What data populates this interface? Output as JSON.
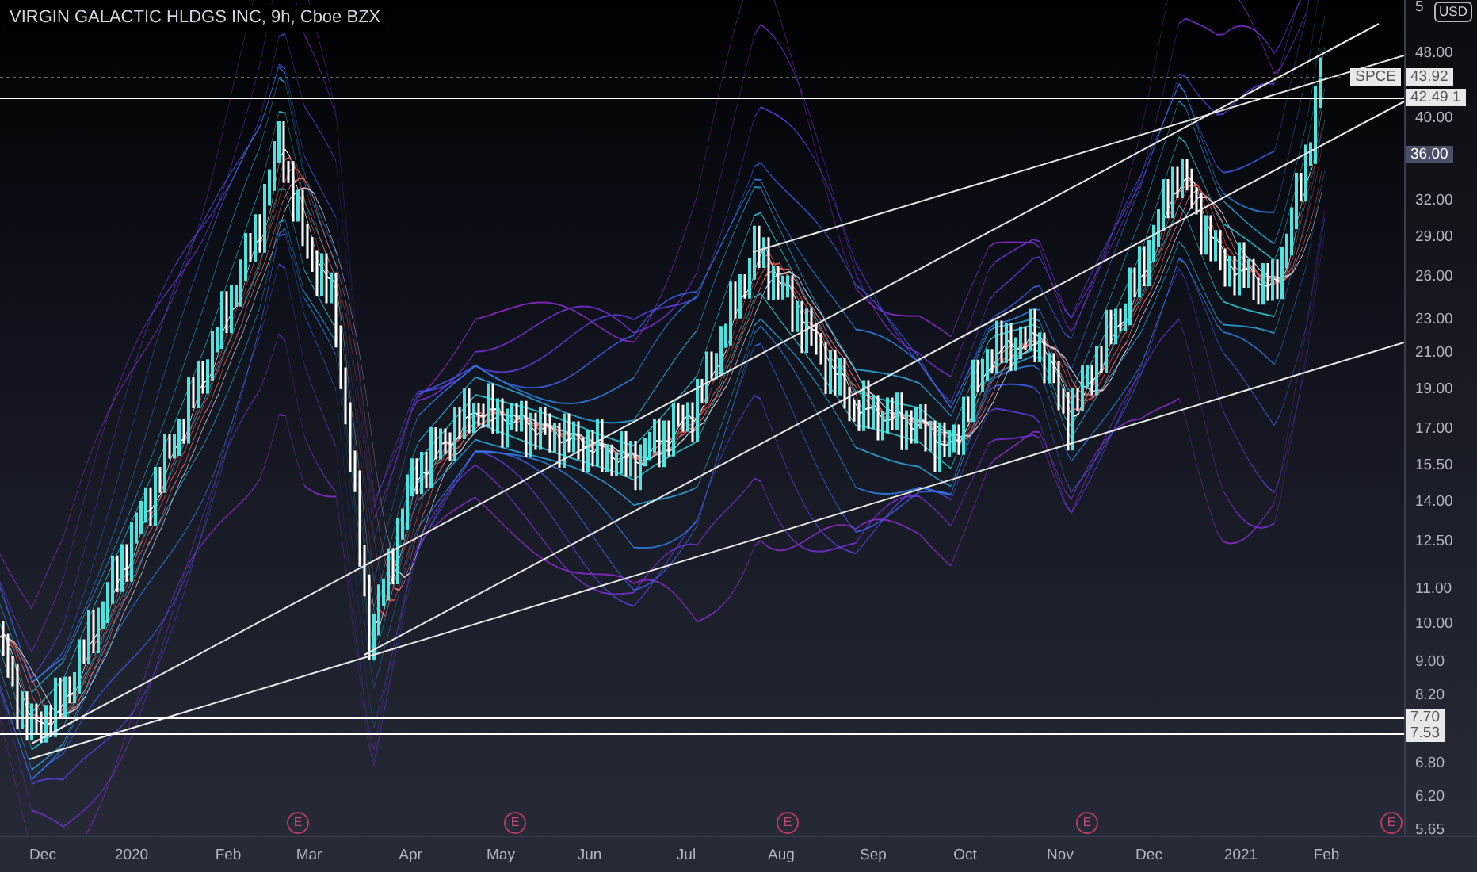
{
  "title": "VIRGIN GALACTIC HLDGS INC, 9h, Cboe BZX",
  "currency": "USD",
  "price_axis": {
    "labels": [
      "5",
      "48.00",
      "40.00",
      "32.00",
      "29.00",
      "26.00",
      "23.00",
      "21.00",
      "19.00",
      "17.00",
      "15.50",
      "14.00",
      "12.50",
      "11.00",
      "10.00",
      "9.00",
      "8.20",
      "6.80",
      "6.20",
      "5.65"
    ]
  },
  "price_tags": [
    {
      "kind": "symbol",
      "symbol": "SPCE",
      "value": "43.92"
    },
    {
      "kind": "line",
      "value": "42.49",
      "marker": "1"
    },
    {
      "kind": "crosshair",
      "value": "36.00"
    },
    {
      "kind": "line",
      "value": "7.70"
    },
    {
      "kind": "line",
      "value": "7.53"
    }
  ],
  "earnings_markers": [
    "E",
    "E",
    "E",
    "E",
    "E"
  ],
  "time_axis": {
    "labels": [
      "Dec",
      "2020",
      "Feb",
      "Mar",
      "Apr",
      "May",
      "Jun",
      "Jul",
      "Aug",
      "Sep",
      "Oct",
      "Nov",
      "Dec",
      "2021",
      "Feb"
    ]
  }
}
